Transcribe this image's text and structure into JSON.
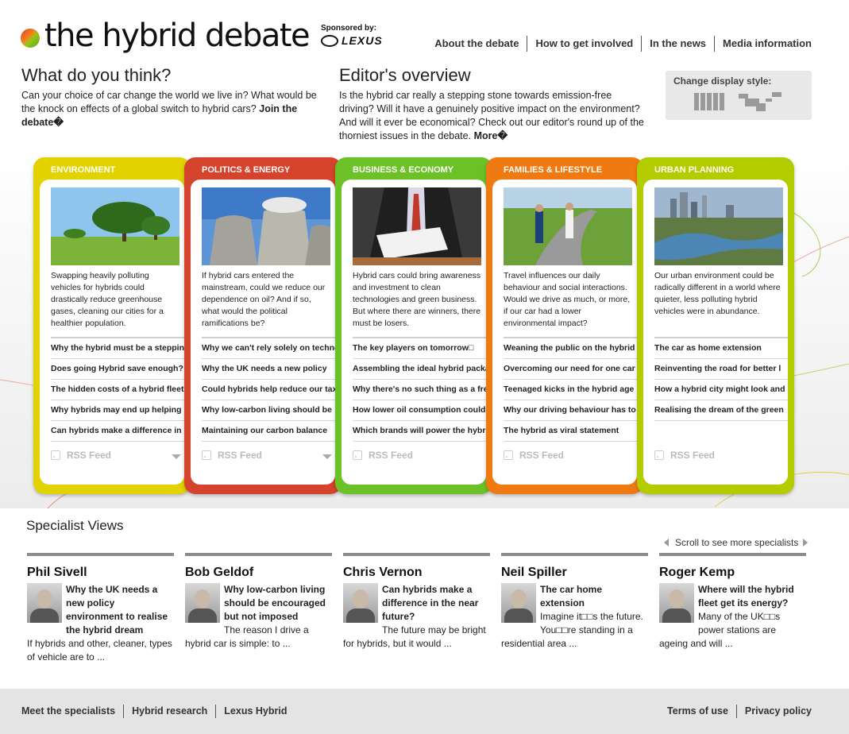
{
  "header": {
    "logo_text": "the hybrid debate",
    "sponsor_label": "Sponsored by:",
    "sponsor_brand": "LEXUS",
    "nav": [
      "About the debate",
      "How to get involved",
      "In the news",
      "Media information"
    ]
  },
  "intro": {
    "left": {
      "title": "What do you think?",
      "text": "Can your choice of car change the world we live in? What would be the knock on effects of a global switch to hybrid cars? ",
      "link": "Join the debate�"
    },
    "right": {
      "title": "Editor's overview",
      "text": "Is the hybrid car really a stepping stone towards emission-free driving? Will it have a genuinely positive impact on the environment? And will it ever be economical? Check out our editor's round up of the thorniest issues in the debate. ",
      "link": "More�"
    },
    "display_style_label": "Change display style:"
  },
  "panels": [
    {
      "title": "Environment",
      "color": "#e2d200",
      "desc": "Swapping heavily polluting vehicles for hybrids could drastically reduce greenhouse gases, cleaning our cities for a healthier population.",
      "links": [
        "Why the hybrid must be a stepping stone",
        "Does going Hybrid save enough?",
        "The hidden costs of a hybrid fleet",
        "Why hybrids may end up helping",
        "Can hybrids make a difference in"
      ],
      "rss": "RSS Feed"
    },
    {
      "title": "Politics & Energy",
      "color": "#d6432c",
      "desc": "If hybrid cars entered the mainstream, could we reduce our dependence on oil? And if so, what would the political ramifications be?",
      "links": [
        "Why we can't rely solely on technology",
        "Why the UK needs a new policy",
        "Could hybrids help reduce our taxes",
        "Why low-carbon living should be",
        "Maintaining our carbon balance"
      ],
      "rss": "RSS Feed"
    },
    {
      "title": "Business & Economy",
      "color": "#6cc127",
      "desc": "Hybrid cars could bring awareness and investment to clean technologies and green business. But where there are winners, there must be losers.",
      "links": [
        "The key players on tomorrow□",
        "Assembling the ideal hybrid package",
        "Why there's no such thing as a free",
        "How lower oil consumption could",
        "Which brands will power the hybrid"
      ],
      "rss": "RSS Feed"
    },
    {
      "title": "Families & Lifestyle",
      "color": "#f07a12",
      "desc": "Travel influences our daily behaviour and social interactions. Would we drive as much, or more, if our car had a lower environmental impact?",
      "links": [
        "Weaning the public on the hybrid",
        "Overcoming our need for one car",
        "Teenaged kicks in the hybrid age",
        "Why our driving behaviour has to",
        "The hybrid as viral statement"
      ],
      "rss": "RSS Feed"
    },
    {
      "title": "Urban Planning",
      "color": "#b2cc00",
      "desc": "Our urban environment could be radically different in a world where quieter, less polluting hybrid vehicles were in abundance.",
      "links": [
        "The car as home extension",
        "Reinventing the road for better l",
        "How a hybrid city might look and",
        "Realising the dream of the green"
      ],
      "rss": "RSS Feed"
    }
  ],
  "specialists": {
    "title": "Specialist Views",
    "scroll_note": "Scroll to see more specialists",
    "items": [
      {
        "name": "Phil Sivell",
        "headline": "Why the UK needs a new policy environment to realise the hybrid dream",
        "excerpt": "If hybrids and other, cleaner, types of vehicle are to ..."
      },
      {
        "name": "Bob Geldof",
        "headline": "Why low-carbon living should be encouraged but not imposed",
        "excerpt": "The reason I drive a hybrid car is simple: to ..."
      },
      {
        "name": "Chris Vernon",
        "headline": "Can hybrids make a difference in the near future?",
        "excerpt": "The future may be bright for hybrids, but it would ..."
      },
      {
        "name": "Neil Spiller",
        "headline": "The car home extension",
        "excerpt": "Imagine it□□s the future. You□□re standing in a residential area ..."
      },
      {
        "name": "Roger Kemp",
        "headline": "Where will the hybrid fleet get its energy?",
        "excerpt": "Many of the UK□□s power stations are ageing and will ..."
      }
    ]
  },
  "footer": {
    "left": [
      "Meet the specialists",
      "Hybrid research",
      "Lexus Hybrid"
    ],
    "right": [
      "Terms of use",
      "Privacy policy"
    ]
  }
}
